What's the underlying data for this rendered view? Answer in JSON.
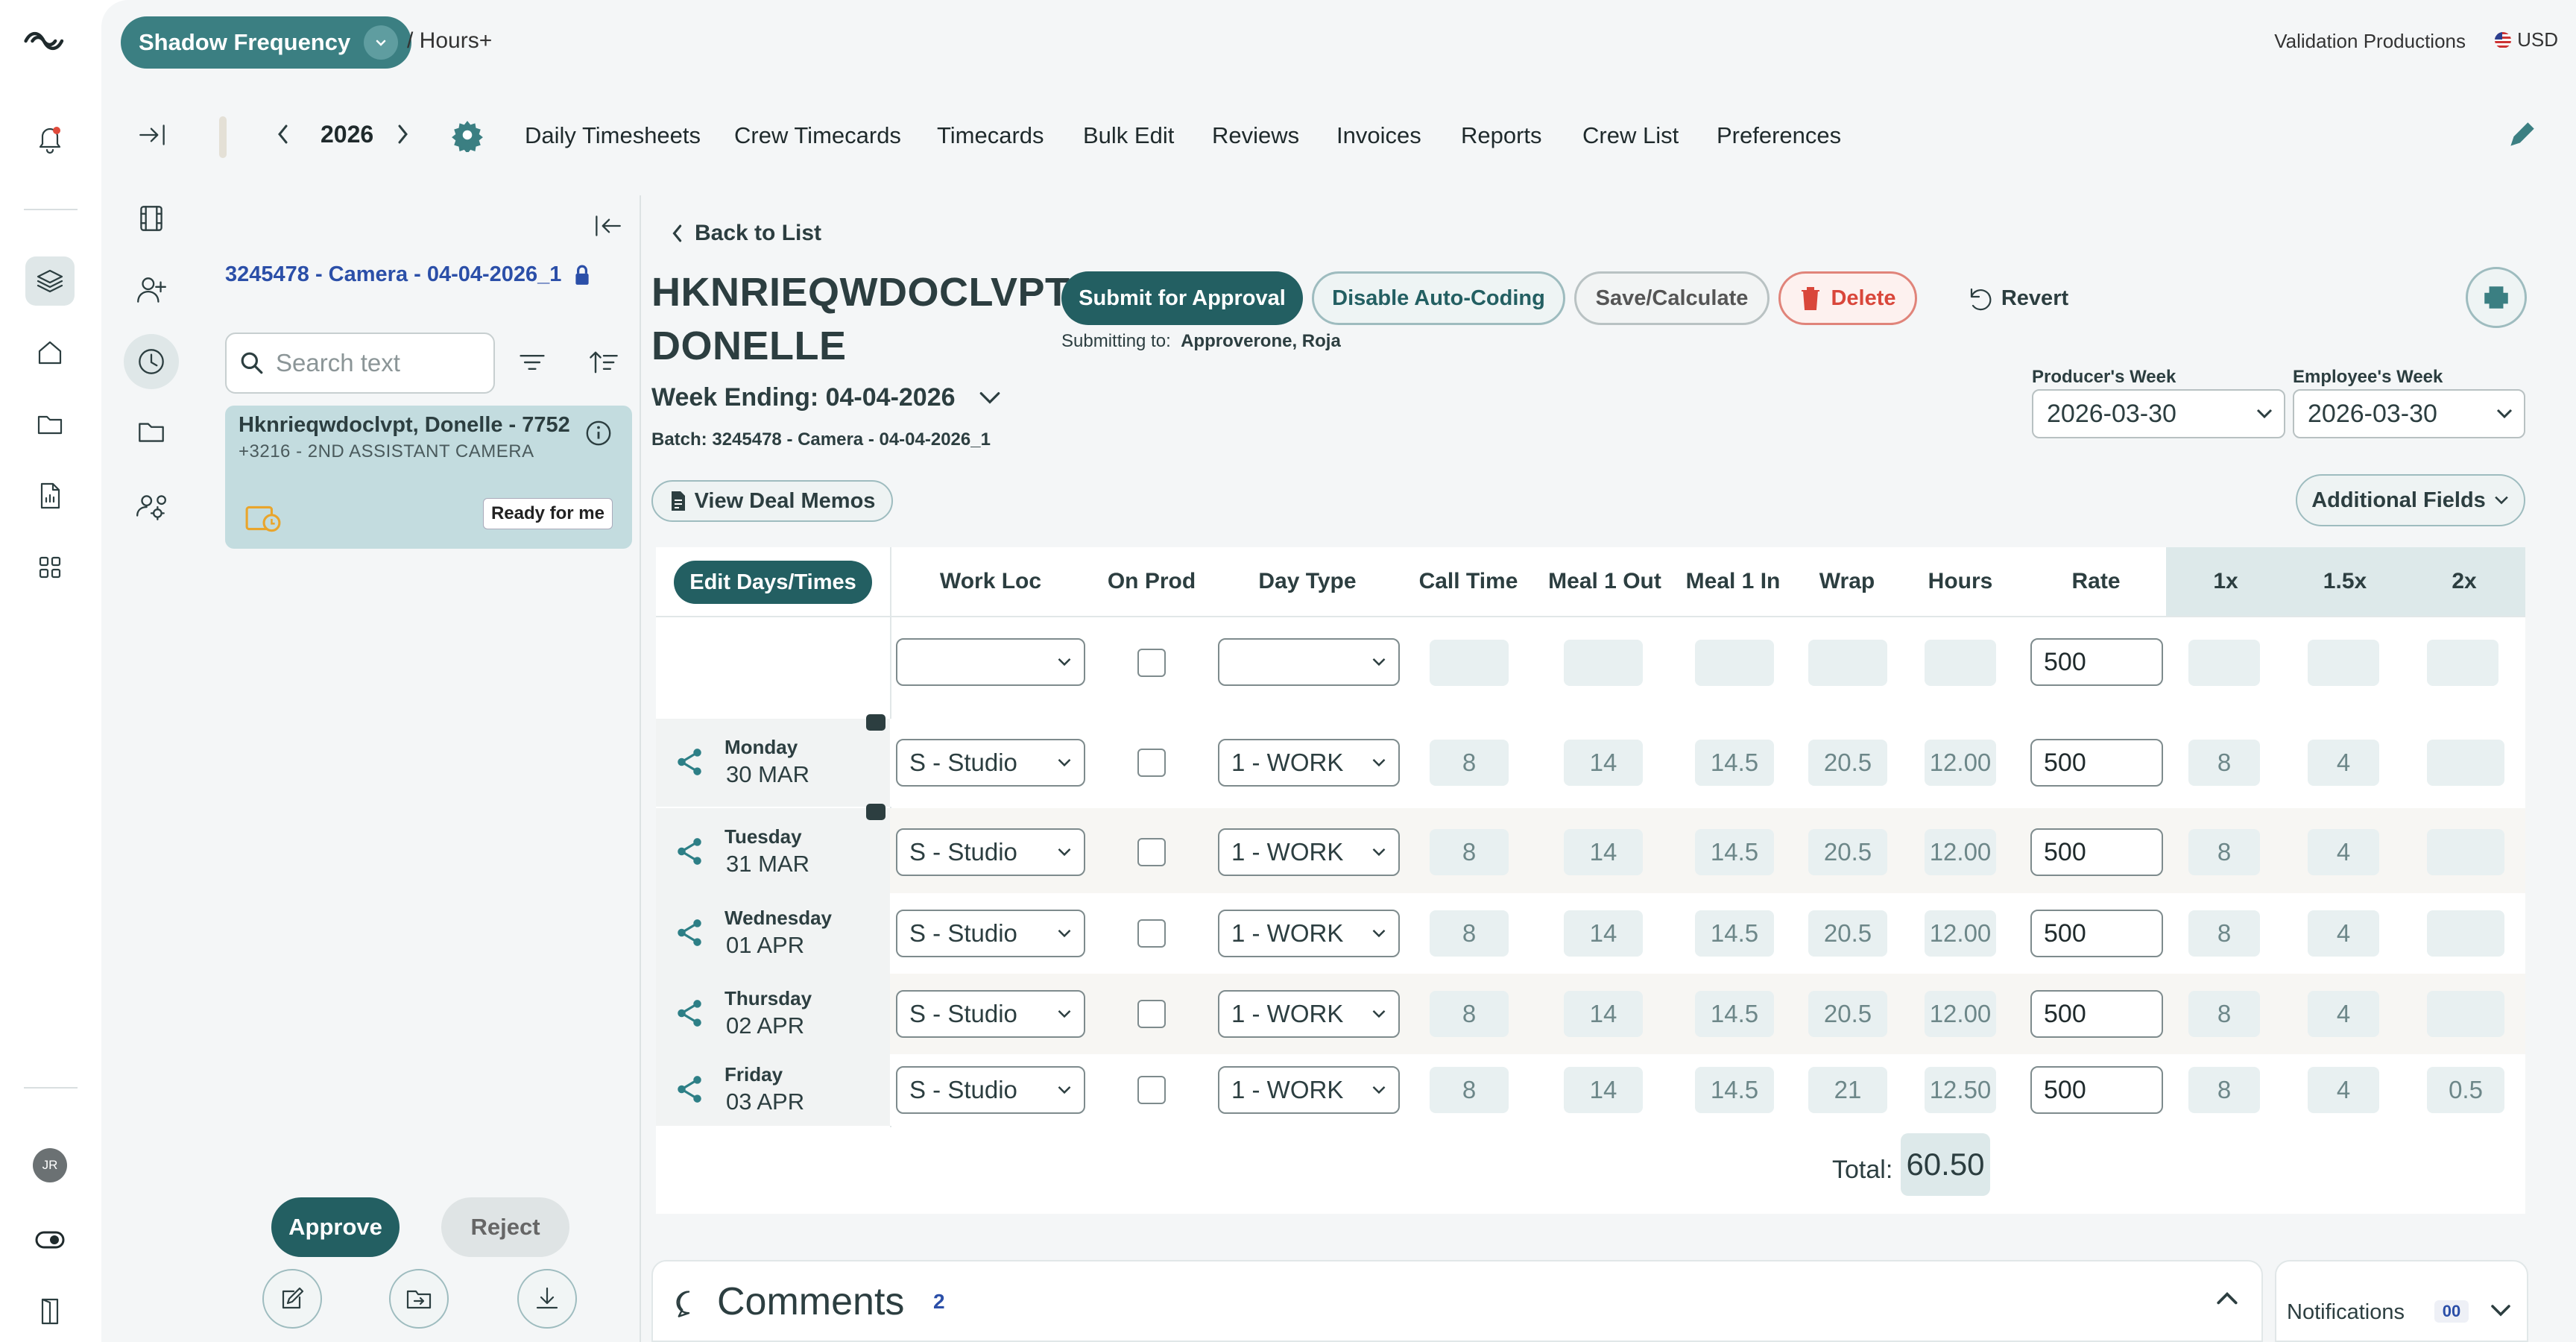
{
  "app": {
    "brand": "Shadow Frequency",
    "breadcrumb": "/ Hours+",
    "company": "Validation Productions",
    "currency": "USD",
    "user_initials": "JR"
  },
  "nav": {
    "year": "2026",
    "items": [
      "Daily Timesheets",
      "Crew Timecards",
      "Timecards",
      "Bulk Edit",
      "Reviews",
      "Invoices",
      "Reports",
      "Crew List",
      "Preferences"
    ]
  },
  "list": {
    "batch_link": "3245478 - Camera - 04-04-2026_1",
    "search_placeholder": "Search text",
    "card": {
      "name": "Hknrieqwdoclvpt, Donelle - 7752",
      "subtitle": "+3216 - 2ND ASSISTANT CAMERA",
      "status": "Ready for me"
    },
    "approve_label": "Approve",
    "reject_label": "Reject"
  },
  "timecard": {
    "back_label": "Back to List",
    "employee_last": "HKNRIEQWDOCLVPT,",
    "employee_first": "DONELLE",
    "week_ending": "Week Ending: 04-04-2026",
    "batch": "Batch: 3245478 - Camera - 04-04-2026_1",
    "buttons": {
      "submit": "Submit for Approval",
      "disable_autocoding": "Disable Auto-Coding",
      "save": "Save/Calculate",
      "delete": "Delete",
      "revert": "Revert",
      "deal_memos": "View Deal Memos",
      "additional_fields": "Additional Fields",
      "edit_days": "Edit Days/Times"
    },
    "submitting_to_label": "Submitting to:",
    "submitting_to_name": "Approverone, Roja",
    "producers_week_label": "Producer's Week",
    "producers_week": "2026-03-30",
    "employees_week_label": "Employee's Week",
    "employees_week": "2026-03-30"
  },
  "grid": {
    "columns": [
      "Work Loc",
      "On Prod",
      "Day Type",
      "Call Time",
      "Meal 1 Out",
      "Meal 1 In",
      "Wrap",
      "Hours",
      "Rate",
      "1x",
      "1.5x",
      "2x"
    ],
    "default_rate": "500",
    "rows": [
      {
        "day": "Monday",
        "date": "30 MAR",
        "work_loc": "S - Studio",
        "day_type": "1 - WORK",
        "call": "8",
        "meal_out": "14",
        "meal_in": "14.5",
        "wrap": "20.5",
        "hours": "12.00",
        "rate": "500",
        "x1": "8",
        "x15": "4",
        "x2": ""
      },
      {
        "day": "Tuesday",
        "date": "31 MAR",
        "work_loc": "S - Studio",
        "day_type": "1 - WORK",
        "call": "8",
        "meal_out": "14",
        "meal_in": "14.5",
        "wrap": "20.5",
        "hours": "12.00",
        "rate": "500",
        "x1": "8",
        "x15": "4",
        "x2": ""
      },
      {
        "day": "Wednesday",
        "date": "01 APR",
        "work_loc": "S - Studio",
        "day_type": "1 - WORK",
        "call": "8",
        "meal_out": "14",
        "meal_in": "14.5",
        "wrap": "20.5",
        "hours": "12.00",
        "rate": "500",
        "x1": "8",
        "x15": "4",
        "x2": ""
      },
      {
        "day": "Thursday",
        "date": "02 APR",
        "work_loc": "S - Studio",
        "day_type": "1 - WORK",
        "call": "8",
        "meal_out": "14",
        "meal_in": "14.5",
        "wrap": "20.5",
        "hours": "12.00",
        "rate": "500",
        "x1": "8",
        "x15": "4",
        "x2": ""
      },
      {
        "day": "Friday",
        "date": "03 APR",
        "work_loc": "S - Studio",
        "day_type": "1 - WORK",
        "call": "8",
        "meal_out": "14",
        "meal_in": "14.5",
        "wrap": "21",
        "hours": "12.50",
        "rate": "500",
        "x1": "8",
        "x15": "4",
        "x2": "0.5"
      }
    ],
    "total_label": "Total:",
    "total": "60.50"
  },
  "comments": {
    "title": "Comments",
    "count": "2"
  },
  "notifications": {
    "title": "Notifications",
    "count": "00"
  },
  "colors": {
    "brand": "#3b7f82",
    "dark_teal": "#235f62",
    "delete": "#d9473b"
  }
}
